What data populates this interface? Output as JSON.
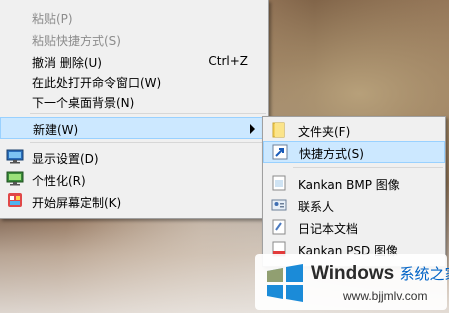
{
  "context_menu": {
    "items": [
      {
        "label": "粘贴(P)",
        "shortcut": "",
        "state": "disabled"
      },
      {
        "label": "粘贴快捷方式(S)",
        "shortcut": "",
        "state": "disabled"
      },
      {
        "label": "撤消 删除(U)",
        "shortcut": "Ctrl+Z",
        "state": "enabled"
      },
      {
        "label": "在此处打开命令窗口(W)",
        "shortcut": "",
        "state": "enabled"
      },
      {
        "label": "下一个桌面背景(N)",
        "shortcut": "",
        "state": "enabled"
      },
      {
        "label": "新建(W)",
        "shortcut": "",
        "state": "highlighted",
        "has_submenu": true
      },
      {
        "label": "显示设置(D)",
        "shortcut": "",
        "state": "enabled",
        "icon": "display-settings-icon"
      },
      {
        "label": "个性化(R)",
        "shortcut": "",
        "state": "enabled",
        "icon": "personalize-icon"
      },
      {
        "label": "开始屏幕定制(K)",
        "shortcut": "",
        "state": "enabled",
        "icon": "start-screen-icon"
      }
    ]
  },
  "submenu": {
    "items": [
      {
        "label": "文件夹(F)",
        "icon": "folder-icon",
        "state": "enabled"
      },
      {
        "label": "快捷方式(S)",
        "icon": "shortcut-icon",
        "state": "highlighted"
      },
      {
        "label": "Kankan BMP 图像",
        "icon": "bmp-image-icon",
        "state": "enabled"
      },
      {
        "label": "联系人",
        "icon": "contact-icon",
        "state": "enabled"
      },
      {
        "label": "日记本文档",
        "icon": "journal-icon",
        "state": "enabled"
      },
      {
        "label": "Kankan PSD 图像",
        "icon": "psd-image-icon",
        "state": "enabled"
      }
    ]
  },
  "watermark": {
    "brand": "Windows",
    "brand_cn": "系统之家",
    "url": "www.bjjmlv.com"
  },
  "colors": {
    "menu_bg": "#f0f0f0",
    "highlight_bg": "#cce8ff",
    "highlight_border": "#99d1ff",
    "disabled_text": "#8c8c8c"
  }
}
